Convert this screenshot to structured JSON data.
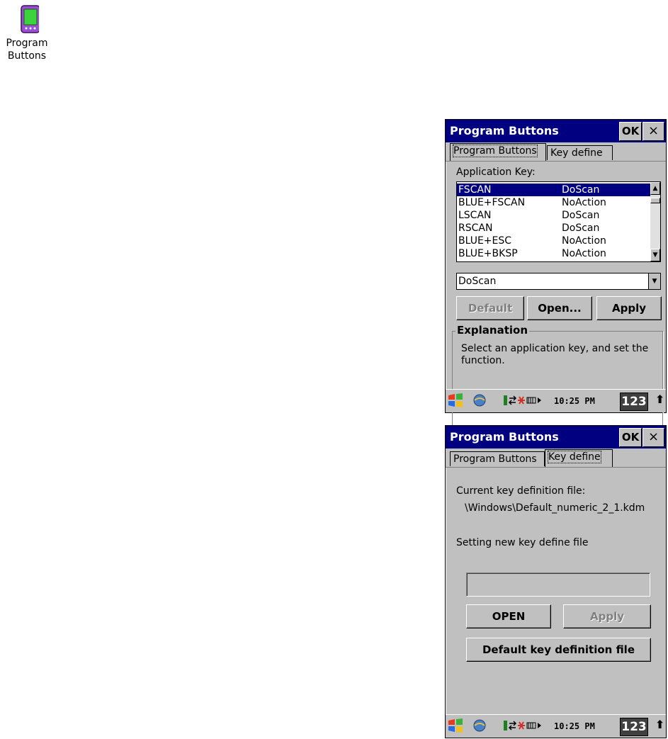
{
  "desktop_icon": {
    "label_line1": "Program",
    "label_line2": "Buttons"
  },
  "window1": {
    "title": "Program Buttons",
    "ok_label": "OK",
    "close_label": "×",
    "tabs": [
      "Program Buttons",
      "Key define"
    ],
    "application_key_label": "Application Key:",
    "list_rows": [
      {
        "key": "FSCAN",
        "action": "DoScan"
      },
      {
        "key": "BLUE+FSCAN",
        "action": "NoAction"
      },
      {
        "key": "LSCAN",
        "action": "DoScan"
      },
      {
        "key": "RSCAN",
        "action": "DoScan"
      },
      {
        "key": "BLUE+ESC",
        "action": "NoAction"
      },
      {
        "key": "BLUE+BKSP",
        "action": "NoAction"
      }
    ],
    "selected_action": "DoScan",
    "buttons": {
      "default": "Default",
      "open": "Open...",
      "apply": "Apply"
    },
    "explanation_title": "Explanation",
    "explanation_text": "Select an application key, and set the function."
  },
  "window2": {
    "title": "Program Buttons",
    "ok_label": "OK",
    "close_label": "×",
    "tabs": [
      "Program Buttons",
      "Key define"
    ],
    "current_file_label": "Current key definition file:",
    "current_file_path": "\\Windows\\Default_numeric_2_1.kdm",
    "new_file_label": "Setting new key define file",
    "new_file_value": "",
    "buttons": {
      "open": "OPEN",
      "apply": "Apply",
      "default_file": "Default key definition file"
    }
  },
  "taskbar": {
    "time": "10:25 PM",
    "input_indicator": "123",
    "up_arrow": "⬆"
  },
  "colors": {
    "titlebar": "#000080",
    "window_bg": "#c0c0c0",
    "selection": "#000080"
  }
}
